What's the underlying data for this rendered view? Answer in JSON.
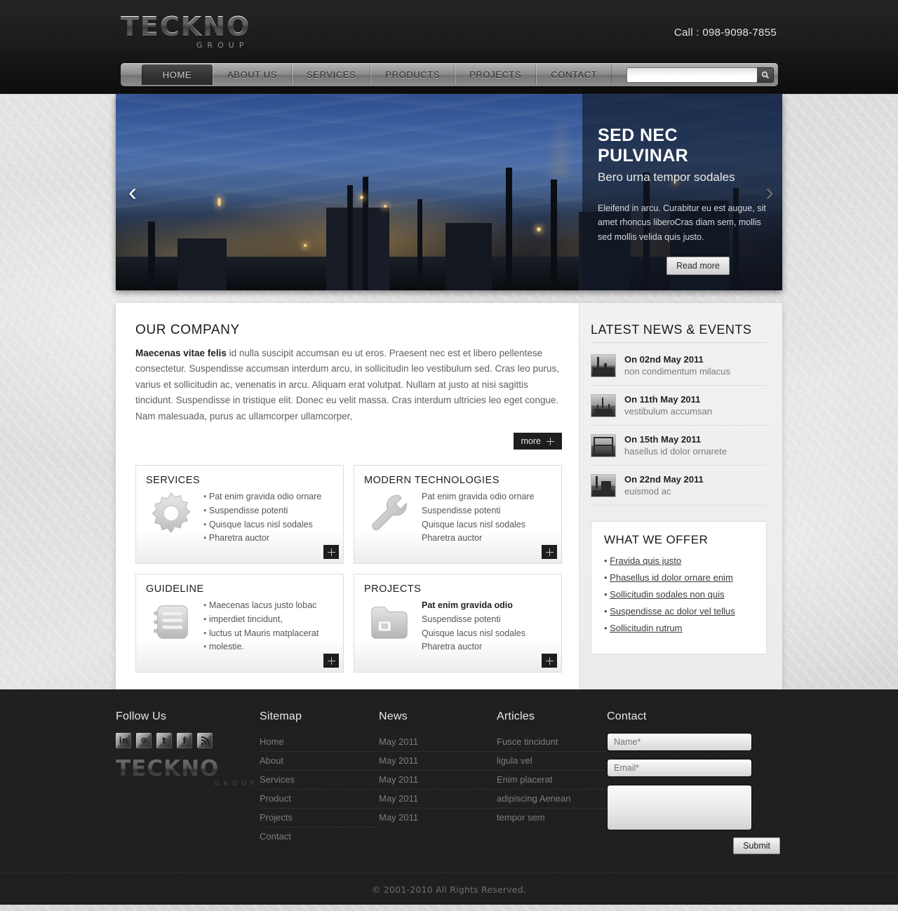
{
  "header": {
    "logo_main": "TECKNO",
    "logo_sub": "GROUP",
    "call": "Call : 098-9098-7855"
  },
  "nav": {
    "items": [
      {
        "label": "HOME",
        "active": true
      },
      {
        "label": "ABOUT US",
        "active": false
      },
      {
        "label": "SERVICES",
        "active": false
      },
      {
        "label": "PRODUCTS",
        "active": false
      },
      {
        "label": "PROJECTS",
        "active": false
      },
      {
        "label": "CONTACT",
        "active": false
      }
    ],
    "search_value": "",
    "search_placeholder": ""
  },
  "hero": {
    "title": "SED NEC PULVINAR",
    "subtitle": "Bero urna tempor sodales",
    "text": "Eleifend in arcu. Curabitur eu est augue, sit amet rhoncus liberoCras diam sem, mollis sed mollis velida quis justo.",
    "button": "Read more",
    "prev": "‹",
    "next": "›"
  },
  "company": {
    "heading": "OUR COMPANY",
    "lead_bold": "Maecenas vitae felis",
    "lead_rest": " id nulla suscipit accumsan eu ut eros. Praesent nec est et libero pellentese consectetur. Suspendisse accumsan interdum arcu, in sollicitudin leo vestibulum sed. Cras leo purus, varius et sollicitudin ac, venenatis in arcu. Aliquam erat volutpat. Nullam at justo at nisi sagittis tincidunt. Suspendisse in tristique elit. Donec eu velit massa. Cras interdum ultricies leo eget congue. Nam malesuada, purus ac ullamcorper ullamcorper,",
    "more": "more"
  },
  "boxes": [
    {
      "title": "SERVICES",
      "icon": "gear-icon",
      "bulleted": true,
      "items": [
        {
          "text": "Pat enim gravida odio ornare",
          "bold": false
        },
        {
          "text": "Suspendisse potenti",
          "bold": false
        },
        {
          "text": "Quisque lacus nisl sodales",
          "bold": false
        },
        {
          "text": "Pharetra auctor",
          "bold": false
        }
      ]
    },
    {
      "title": "MODERN TECHNOLOGIES",
      "icon": "wrench-icon",
      "bulleted": false,
      "items": [
        {
          "text": "Pat enim gravida odio ornare",
          "bold": false
        },
        {
          "text": "Suspendisse potenti",
          "bold": false
        },
        {
          "text": "Quisque lacus nisl sodales",
          "bold": false
        },
        {
          "text": "Pharetra auctor",
          "bold": false
        }
      ]
    },
    {
      "title": "GUIDELINE",
      "icon": "notebook-icon",
      "bulleted": true,
      "items": [
        {
          "text": "Maecenas lacus justo lobac",
          "bold": false
        },
        {
          "text": "imperdiet tincidunt,",
          "bold": false
        },
        {
          "text": "luctus ut Mauris matplacerat",
          "bold": false
        },
        {
          "text": "molestie.",
          "bold": false
        }
      ]
    },
    {
      "title": "PROJECTS",
      "icon": "folder-icon",
      "bulleted": false,
      "items": [
        {
          "text": "Pat enim gravida odio",
          "bold": true
        },
        {
          "text": "Suspendisse potenti",
          "bold": false
        },
        {
          "text": "Quisque lacus nisl sodales",
          "bold": false
        },
        {
          "text": "Pharetra auctor",
          "bold": false
        }
      ]
    }
  ],
  "news": {
    "heading": "LATEST NEWS & EVENTS",
    "items": [
      {
        "date": "On 02nd May 2011",
        "desc": "non condimentum milacus"
      },
      {
        "date": "On 11th May 2011",
        "desc": "vestibulum accumsan"
      },
      {
        "date": "On 15th May 2011",
        "desc": "hasellus id dolor ornarete"
      },
      {
        "date": "On 22nd May 2011",
        "desc": "euismod ac"
      }
    ]
  },
  "offer": {
    "heading": "WHAT WE OFFER",
    "items": [
      "Fravida quis justo",
      "Phasellus id dolor ornare enim",
      "Sollicitudin sodales non quis",
      "Suspendisse ac dolor vel tellus",
      "Sollicitudin rutrum"
    ]
  },
  "footer": {
    "follow": {
      "heading": "Follow Us",
      "socials": [
        {
          "name": "linkedin-icon",
          "glyph": "in"
        },
        {
          "name": "myspace-icon",
          "glyph": "☸"
        },
        {
          "name": "twitter-icon",
          "glyph": "t"
        },
        {
          "name": "facebook-icon",
          "glyph": "f"
        },
        {
          "name": "rss-icon",
          "glyph": "◠"
        }
      ],
      "logo_main": "TECKNO",
      "logo_sub": "GROUP"
    },
    "sitemap": {
      "heading": "Sitemap",
      "items": [
        "Home",
        "About",
        "Services",
        "Product",
        "Projects",
        "Contact"
      ]
    },
    "news": {
      "heading": "News",
      "items": [
        "May 2011",
        "May 2011",
        "May 2011",
        "May 2011",
        "May 2011"
      ]
    },
    "articles": {
      "heading": "Articles",
      "items": [
        "Fusce tincidunt",
        "ligula vel",
        "Enim placerat",
        "adipiscing Aenean",
        "tempor sem"
      ]
    },
    "contact": {
      "heading": "Contact",
      "name_placeholder": "Name*",
      "name_value": "",
      "email_placeholder": "Email*",
      "email_value": "",
      "message_placeholder": "",
      "message_value": "",
      "submit": "Submit"
    },
    "copyright": "© 2001-2010 All Rights Reserved."
  }
}
